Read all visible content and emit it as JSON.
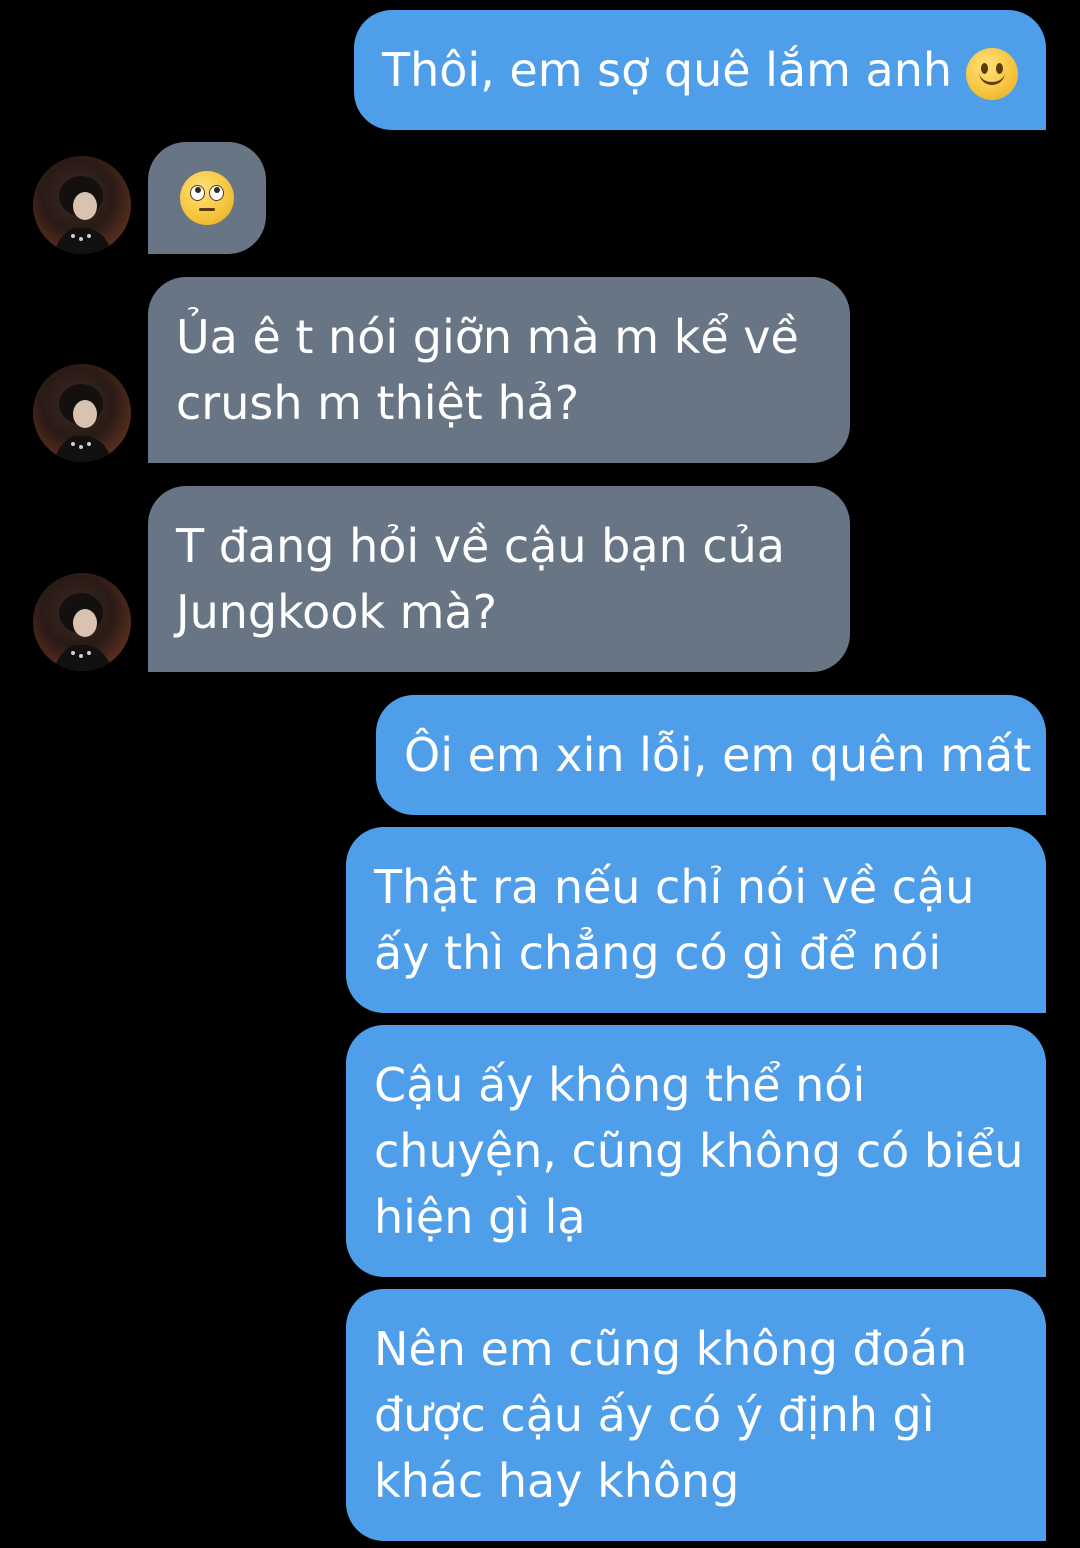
{
  "messages": [
    {
      "side": "sent",
      "text": "Thôi, em sợ quê lắm anh",
      "emoji": "slightly-smiling-face"
    },
    {
      "side": "received",
      "emoji": "face-with-rolling-eyes"
    },
    {
      "side": "received",
      "lines": [
        "Ủa ê t nói giỡn mà m kể về",
        "crush m thiệt hả?"
      ]
    },
    {
      "side": "received",
      "lines": [
        "T đang hỏi về cậu bạn của",
        "Jungkook mà?"
      ]
    },
    {
      "side": "sent",
      "lines": [
        "Ôi em xin lỗi, em quên mất"
      ]
    },
    {
      "side": "sent",
      "lines": [
        "Thật ra nếu chỉ nói về cậu",
        "ấy thì chẳng có gì để nói"
      ]
    },
    {
      "side": "sent",
      "lines": [
        "Cậu ấy không thể nói",
        "chuyện, cũng không có biểu",
        "hiện gì lạ"
      ]
    },
    {
      "side": "sent",
      "lines": [
        "Nên em cũng không đoán",
        "được cậu ấy có ý định gì",
        "khác hay không"
      ]
    }
  ],
  "colors": {
    "background": "#000000",
    "sent_bubble": "#4f9eea",
    "received_bubble": "#687585",
    "text": "#ffffff"
  },
  "icons": {
    "avatar": "contact-avatar-photo"
  }
}
